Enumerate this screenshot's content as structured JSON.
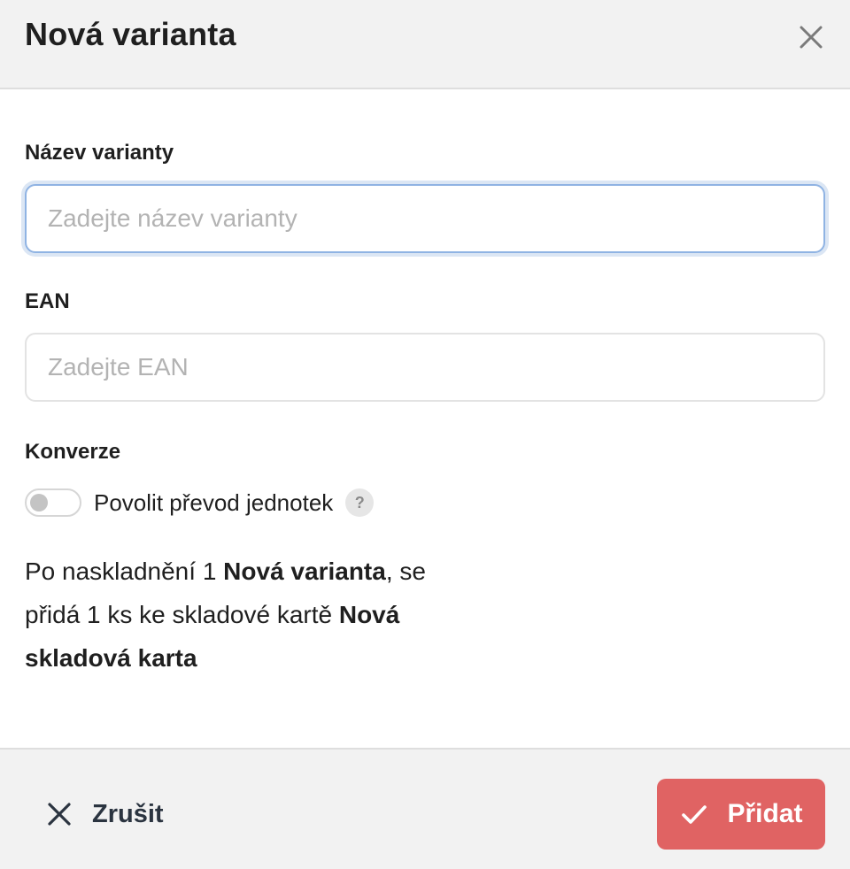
{
  "header": {
    "title": "Nová varianta",
    "close_icon": "close-icon"
  },
  "form": {
    "name_field": {
      "label": "Název varianty",
      "value": "",
      "placeholder": "Zadejte název varianty"
    },
    "ean_field": {
      "label": "EAN",
      "value": "",
      "placeholder": "Zadejte EAN"
    },
    "conversion": {
      "label": "Konverze",
      "toggle_label": "Povolit převod jednotek",
      "toggle_on": false,
      "help_glyph": "?"
    },
    "info": {
      "part1": "Po naskladnění 1 ",
      "variant_name": "Nová varianta",
      "part2": ", se přidá 1 ks ke skladové kartě ",
      "card_name": "Nová skladová karta"
    }
  },
  "footer": {
    "cancel_label": "Zrušit",
    "add_label": "Přidat"
  },
  "colors": {
    "primary": "#e06363",
    "focus_border": "#8fb3e3",
    "header_bg": "#f2f2f2"
  }
}
